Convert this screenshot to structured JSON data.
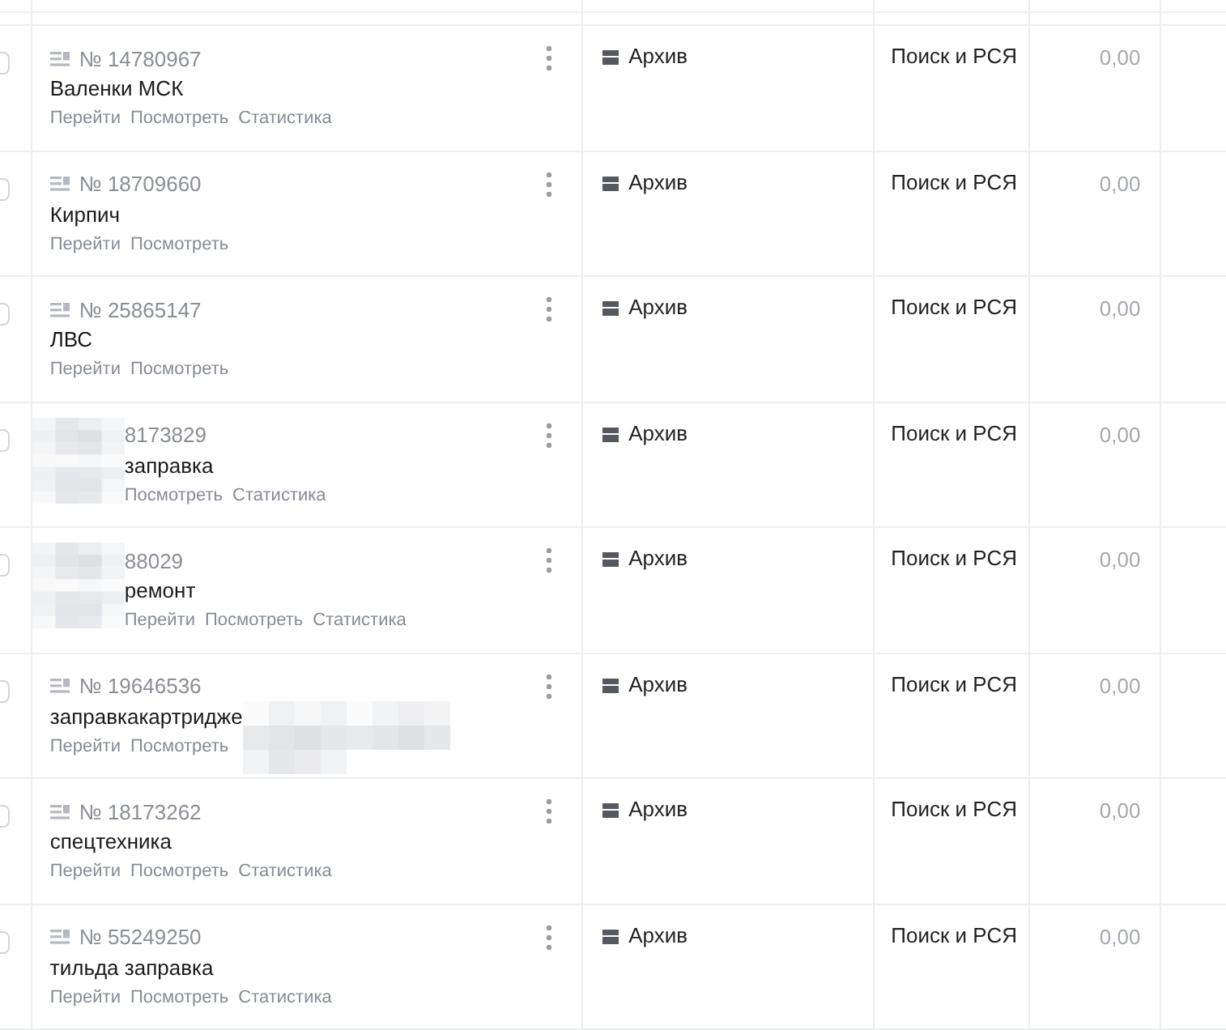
{
  "rows": [
    {
      "checked": false,
      "number": "№ 14780967",
      "name": "Валенки МСК",
      "links": [
        "Перейти",
        "Посмотреть",
        "Статистика"
      ],
      "status": "Архив",
      "strategy": "Поиск и РСЯ",
      "value": "0,00"
    },
    {
      "checked": false,
      "number": "№ 18709660",
      "name": "Кирпич",
      "links": [
        "Перейти",
        "Посмотреть"
      ],
      "status": "Архив",
      "strategy": "Поиск и РСЯ",
      "value": "0,00"
    },
    {
      "checked": false,
      "number": "№ 25865147",
      "name": "ЛВС",
      "links": [
        "Перейти",
        "Посмотреть"
      ],
      "status": "Архив",
      "strategy": "Поиск и РСЯ",
      "value": "0,00"
    },
    {
      "checked": false,
      "obscured_left": true,
      "number": "8173829",
      "name": "заправка",
      "links": [
        "Посмотреть",
        "Статистика"
      ],
      "status": "Архив",
      "strategy": "Поиск и РСЯ",
      "value": "0,00"
    },
    {
      "checked": false,
      "obscured_left": true,
      "number": "88029",
      "name": "ремонт",
      "links": [
        "Перейти",
        "Посмотреть",
        "Статистика"
      ],
      "status": "Архив",
      "strategy": "Поиск и РСЯ",
      "value": "0,00"
    },
    {
      "checked": false,
      "obscured_right": true,
      "number": "№ 19646536",
      "name": "заправкакартридже",
      "links": [
        "Перейти",
        "Посмотреть"
      ],
      "status": "Архив",
      "strategy": "Поиск и РСЯ",
      "value": "0,00"
    },
    {
      "checked": false,
      "number": "№ 18173262",
      "name": "спецтехника",
      "links": [
        "Перейти",
        "Посмотреть",
        "Статистика"
      ],
      "status": "Архив",
      "strategy": "Поиск и РСЯ",
      "value": "0,00"
    },
    {
      "checked": false,
      "number": "№ 55249250",
      "name": "тильда заправка",
      "links": [
        "Перейти",
        "Посмотреть",
        "Статистика"
      ],
      "status": "Архив",
      "strategy": "Поиск и РСЯ",
      "value": "0,00"
    }
  ]
}
